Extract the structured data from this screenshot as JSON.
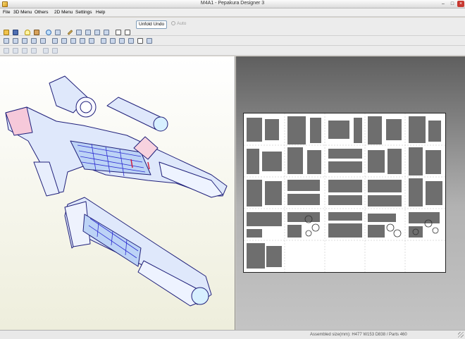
{
  "window": {
    "title": "M4A1 - Pepakura Designer 3"
  },
  "menu": [
    "File",
    "3D Menu",
    "Others",
    "2D Menu",
    "Settings",
    "Help"
  ],
  "toolbar": {
    "unfold_label": "Unfold Undo",
    "auto_label": "Auto"
  },
  "status": {
    "text": "Assembled size(mm): H477 W153 D838 / Parts 460"
  }
}
